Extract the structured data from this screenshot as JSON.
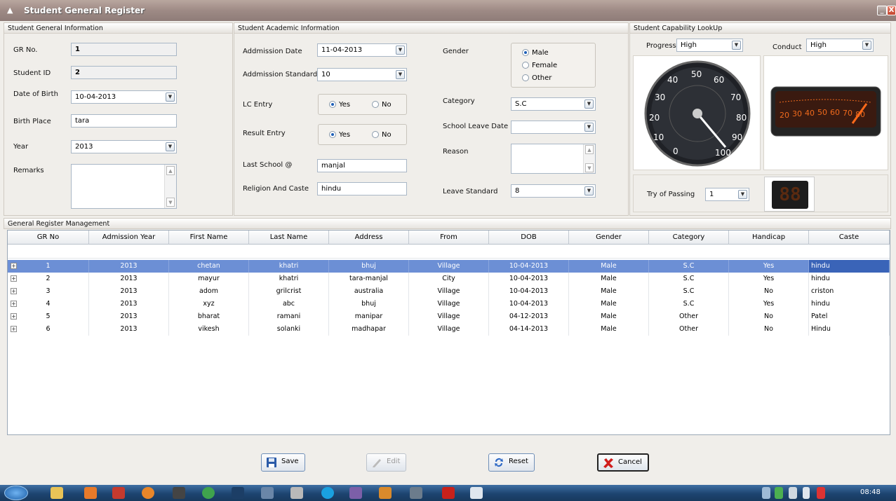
{
  "window": {
    "title": "Student General Register",
    "min": "_",
    "close": "X"
  },
  "general": {
    "title": "Student General Information",
    "gr_label": "GR No.",
    "gr_value": "1",
    "sid_label": "Student ID",
    "sid_value": "2",
    "dob_label": "Date of Birth",
    "dob_value": "10-04-2013",
    "birthplace_label": "Birth Place",
    "birthplace_value": "tara",
    "year_label": "Year",
    "year_value": "2013",
    "remarks_label": "Remarks"
  },
  "academic": {
    "title": "Student Academic Information",
    "adm_date_label": "Addmission Date",
    "adm_date_value": "11-04-2013",
    "adm_std_label": "Addmission Standard",
    "adm_std_value": "10",
    "lc_label": "LC Entry",
    "result_label": "Result Entry",
    "yes": "Yes",
    "no": "No",
    "last_school_label": "Last School @",
    "last_school_value": "manjal",
    "religion_label": "Religion And Caste",
    "religion_value": "hindu",
    "gender_label": "Gender",
    "gender_options": [
      "Male",
      "Female",
      "Other"
    ],
    "category_label": "Category",
    "category_value": "S.C",
    "leave_date_label": "School Leave Date",
    "leave_date_value": "",
    "reason_label": "Reason",
    "leave_std_label": "Leave Standard",
    "leave_std_value": "8"
  },
  "capability": {
    "title": "Student Capability LookUp",
    "progress_label": "Progress",
    "progress_value": "High",
    "conduct_label": "Conduct",
    "conduct_value": "High",
    "gauge1_ticks": [
      "30",
      "40",
      "50",
      "60",
      "70",
      "80",
      "90",
      "100",
      "20",
      "10",
      "0"
    ],
    "gauge2_ticks": [
      "20",
      "30",
      "40",
      "50",
      "60",
      "70",
      "80"
    ],
    "try_label": "Try of Passing",
    "try_value": "1",
    "digit_display": "88"
  },
  "grid": {
    "title": "General Register Management",
    "columns": [
      "GR No",
      "Admission Year",
      "First Name",
      "Last Name",
      "Address",
      "From",
      "DOB",
      "Gender",
      "Category",
      "Handicap",
      "Caste"
    ],
    "rows": [
      [
        "1",
        "2013",
        "chetan",
        "khatri",
        "bhuj",
        "Village",
        "10-04-2013",
        "Male",
        "S.C",
        "Yes",
        "hindu"
      ],
      [
        "2",
        "2013",
        "mayur",
        "khatri",
        "tara-manjal",
        "City",
        "10-04-2013",
        "Male",
        "S.C",
        "Yes",
        "hindu"
      ],
      [
        "3",
        "2013",
        "adom",
        "grilcrist",
        "australia",
        "Village",
        "10-04-2013",
        "Male",
        "S.C",
        "No",
        "criston"
      ],
      [
        "4",
        "2013",
        "xyz",
        "abc",
        "bhuj",
        "Village",
        "10-04-2013",
        "Male",
        "S.C",
        "Yes",
        "hindu"
      ],
      [
        "5",
        "2013",
        "bharat",
        "ramani",
        "manipar",
        "Village",
        "04-12-2013",
        "Male",
        "Other",
        "No",
        "Patel"
      ],
      [
        "6",
        "2013",
        "vikesh",
        "solanki",
        "madhapar",
        "Village",
        "04-14-2013",
        "Male",
        "Other",
        "No",
        "Hindu"
      ]
    ]
  },
  "buttons": {
    "save": "Save",
    "edit": "Edit",
    "reset": "Reset",
    "cancel": "Cancel"
  },
  "taskbar": {
    "clock": "08:48"
  },
  "colors": {
    "selection": "#6c8fd5",
    "title_bar": "#9e8a85",
    "taskbar": "#1d4470"
  }
}
